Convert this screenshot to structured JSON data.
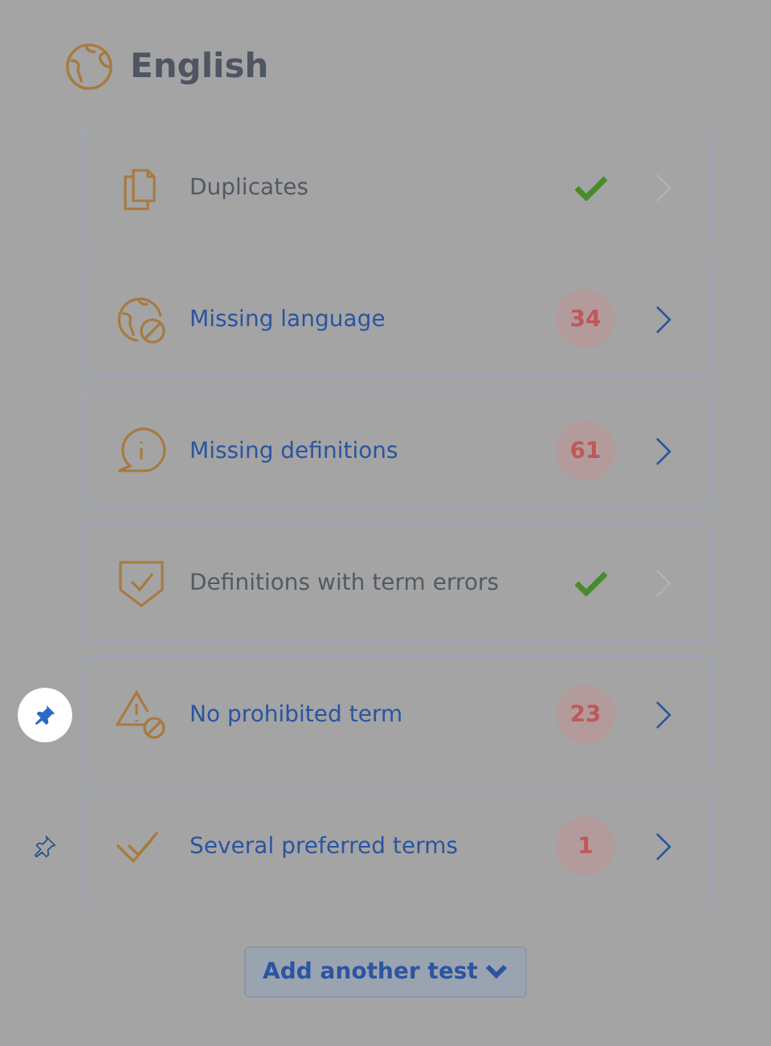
{
  "heading": "English",
  "tests": [
    {
      "label": "Duplicates",
      "kind": "passed"
    },
    {
      "label": "Missing language",
      "kind": "count",
      "count": "34"
    },
    {
      "label": "Missing definitions",
      "kind": "count",
      "count": "61"
    },
    {
      "label": "Definitions with term errors",
      "kind": "passed"
    },
    {
      "label": "No prohibited term",
      "kind": "count",
      "count": "23",
      "pinned": true
    },
    {
      "label": "Several preferred terms",
      "kind": "count",
      "count": "1",
      "pinned": false
    }
  ],
  "add_button": "Add another test"
}
